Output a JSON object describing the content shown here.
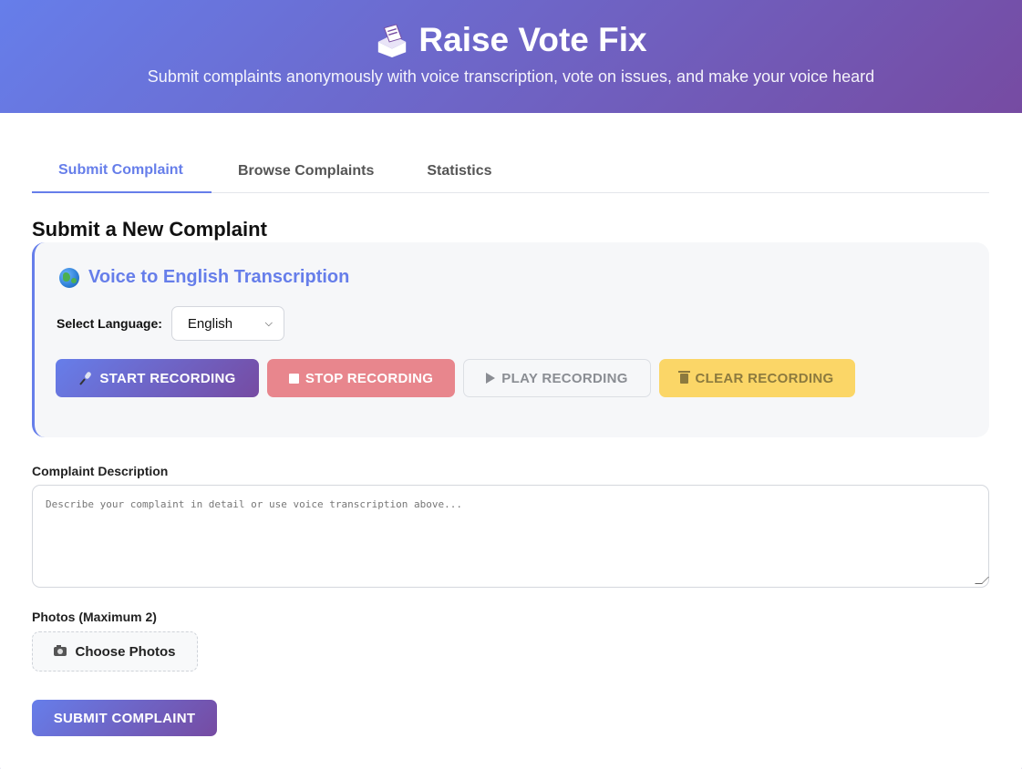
{
  "header": {
    "title": "Raise Vote Fix",
    "icon": "ballot-box-icon",
    "subtitle": "Submit complaints anonymously with voice transcription, vote on issues, and make your voice heard"
  },
  "tabs": [
    {
      "label": "Submit Complaint",
      "active": true
    },
    {
      "label": "Browse Complaints",
      "active": false
    },
    {
      "label": "Statistics",
      "active": false
    }
  ],
  "form": {
    "title": "Submit a New Complaint",
    "voice": {
      "title": "Voice to English Transcription",
      "icon": "globe-icon",
      "language_label": "Select Language:",
      "language_value": "English",
      "buttons": {
        "start": "START RECORDING",
        "stop": "STOP RECORDING",
        "play": "PLAY RECORDING",
        "clear": "CLEAR RECORDING"
      }
    },
    "description_label": "Complaint Description",
    "description_placeholder": "Describe your complaint in detail or use voice transcription above...",
    "photos_label": "Photos (Maximum 2)",
    "choose_photos": "Choose Photos",
    "submit": "SUBMIT COMPLAINT"
  },
  "colors": {
    "accent": "#667eea",
    "accent_end": "#764ba2",
    "stop": "#e8868d",
    "clear": "#fbd667"
  }
}
